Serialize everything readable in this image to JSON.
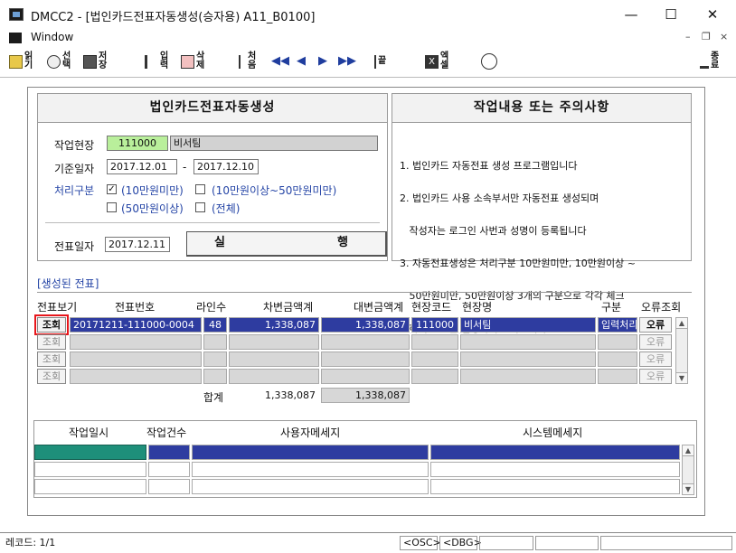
{
  "window": {
    "title": "DMCC2 - [법인카드전표자동생성(승자용) A11_B0100]",
    "minimize": "—",
    "maximize": "☐",
    "close": "✕"
  },
  "menubar": {
    "menu_label": "Window",
    "mdi_min": "–",
    "mdi_restore": "❐",
    "mdi_close": "×"
  },
  "toolbar": {
    "read": "읽기",
    "select": "선택",
    "save": "저장",
    "input": "입력",
    "delete": "삭제",
    "first": "처음",
    "last": "끝",
    "excel": "엑셀",
    "exit": "종료",
    "nav_prevfast": "◀◀",
    "nav_prev": "◀",
    "nav_next": "▶",
    "nav_nextfast": "▶▶"
  },
  "left_panel": {
    "header": "법인카드전표자동생성",
    "site_label": "작업현장",
    "site_code": "111000",
    "site_name": "비서팀",
    "date_label": "기준일자",
    "date_from": "2017.12.01",
    "date_sep": "-",
    "date_to": "2017.12.10",
    "proc_label": "처리구분",
    "opt1": "(10만원미만)",
    "opt2": "(10만원이상~50만원미만)",
    "opt3": "(50만원이상)",
    "opt4": "(전체)",
    "opt1_checked": "✓",
    "voucher_date_label": "전표일자",
    "voucher_date": "2017.12.11",
    "run_label_1": "실",
    "run_label_2": "행"
  },
  "right_panel": {
    "header": "작업내용 또는 주의사항",
    "notes": [
      "1. 법인카드 자동전표 생성 프로그램입니다",
      "2. 법인카드 사용 소속부서만 자동전표 생성되며",
      "   작성자는 로그인 사번과 성명이 등록됩니다",
      "3. 자동전표생성은 처리구분 10만원미만, 10만원이상 ~",
      "   50만원미만, 50만원이상 3개의 구분으로 각각 체크",
      "   하여 전표를 실행하기시 바랍니다."
    ]
  },
  "generated": {
    "section_label": "[생성된 전표]",
    "columns": [
      "전표보기",
      "전표번호",
      "라인수",
      "차변금액계",
      "대변금액계",
      "현장코드",
      "현장명",
      "구분",
      "오류조회"
    ],
    "rows": [
      {
        "view": "조회",
        "voucher_no": "20171211-111000-0004",
        "lines": "48",
        "debit": "1,338,087",
        "credit": "1,338,087",
        "site_code": "111000",
        "site_name": "비서팀",
        "type": "입력처리",
        "error": "오류"
      },
      {
        "view": "조회",
        "voucher_no": "",
        "lines": "",
        "debit": "",
        "credit": "",
        "site_code": "",
        "site_name": "",
        "type": "",
        "error": "오류"
      },
      {
        "view": "조회",
        "voucher_no": "",
        "lines": "",
        "debit": "",
        "credit": "",
        "site_code": "",
        "site_name": "",
        "type": "",
        "error": "오류"
      },
      {
        "view": "조회",
        "voucher_no": "",
        "lines": "",
        "debit": "",
        "credit": "",
        "site_code": "",
        "site_name": "",
        "type": "",
        "error": "오류"
      }
    ],
    "total_label": "합계",
    "total_debit": "1,338,087",
    "total_credit": "1,338,087"
  },
  "log": {
    "columns": [
      "작업일시",
      "작업건수",
      "사용자메세지",
      "시스템메세지"
    ]
  },
  "status": {
    "record": "레코드: 1/1",
    "osc": "<OSC>",
    "dbg": "<DBG>"
  },
  "colors": {
    "selected_row": "#2e3ca0",
    "site_code_bg": "#b9ef9b",
    "highlight_box": "#e8161b",
    "grid_fill": "#d7d7d7"
  }
}
